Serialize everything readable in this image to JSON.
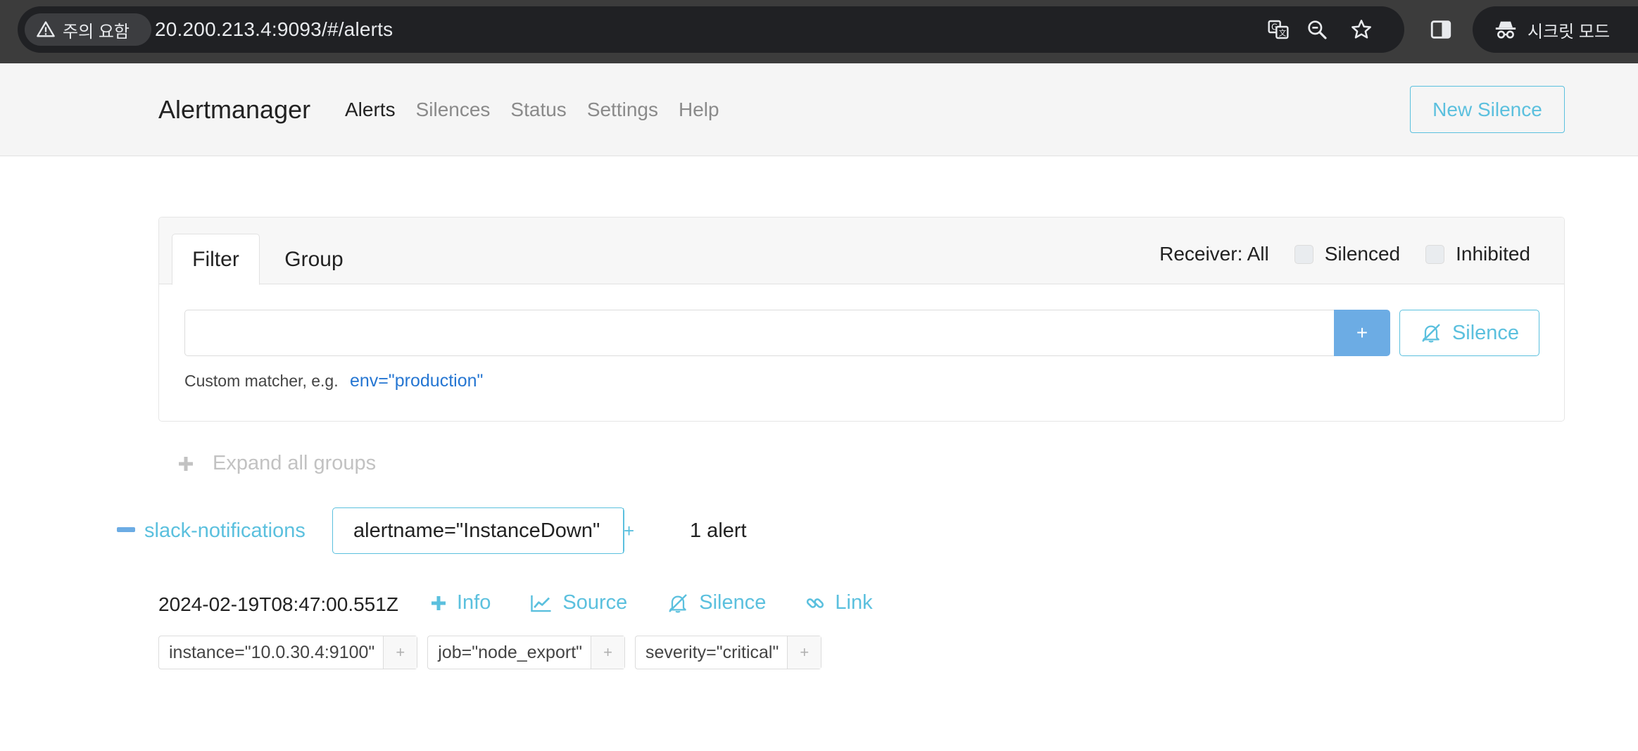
{
  "browser": {
    "security_label": "주의 요함",
    "url": "20.200.213.4:9093/#/alerts",
    "incognito_label": "시크릿 모드"
  },
  "navbar": {
    "brand": "Alertmanager",
    "links": [
      {
        "label": "Alerts",
        "active": true
      },
      {
        "label": "Silences",
        "active": false
      },
      {
        "label": "Status",
        "active": false
      },
      {
        "label": "Settings",
        "active": false
      },
      {
        "label": "Help",
        "active": false
      }
    ],
    "new_silence_label": "New Silence"
  },
  "filter_card": {
    "tabs": [
      "Filter",
      "Group"
    ],
    "receiver_label": "Receiver: All",
    "silenced_label": "Silenced",
    "inhibited_label": "Inhibited",
    "input_value": "",
    "plus_label": "+",
    "silence_label": "Silence",
    "hint_text": "Custom matcher, e.g.",
    "hint_example": "env=\"production\""
  },
  "expand_all_label": "Expand all groups",
  "group": {
    "receiver": "slack-notifications",
    "label": "alertname=\"InstanceDown\"",
    "label_plus": "+",
    "count": "1 alert"
  },
  "alert": {
    "timestamp": "2024-02-19T08:47:00.551Z",
    "actions": [
      "Info",
      "Source",
      "Silence",
      "Link"
    ],
    "labels": [
      {
        "text": "instance=\"10.0.30.4:9100\""
      },
      {
        "text": "job=\"node_export\""
      },
      {
        "text": "severity=\"critical\""
      }
    ],
    "label_add": "+"
  },
  "colors": {
    "accent": "#5bc0de",
    "primary_button": "#6cace4",
    "link": "#2576d2",
    "chrome_bg": "#3c3c3c"
  }
}
